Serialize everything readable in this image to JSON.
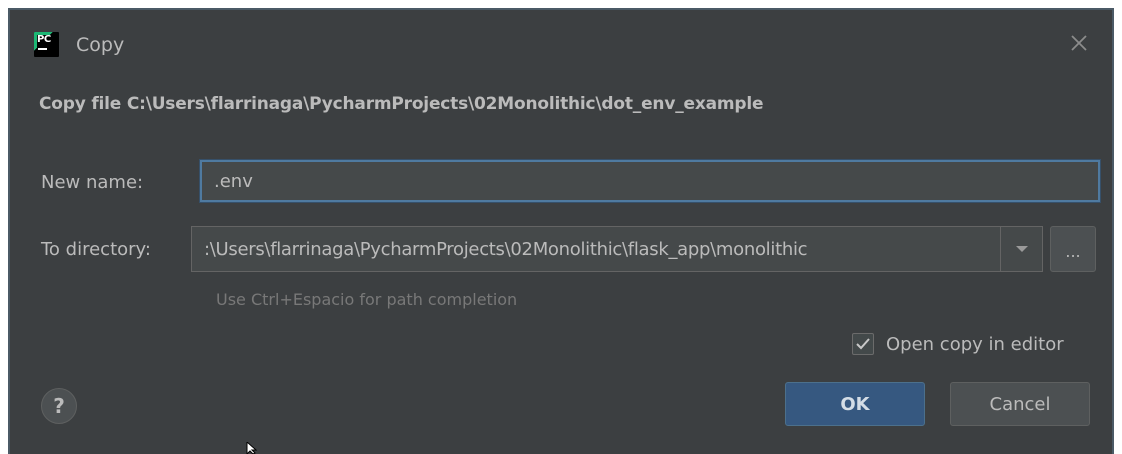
{
  "window": {
    "title": "Copy",
    "app_icon_text": "PC",
    "close_icon": "close-icon"
  },
  "header": {
    "text": "Copy file C:\\Users\\flarrinaga\\PycharmProjects\\02Monolithic\\dot_env_example"
  },
  "form": {
    "new_name_label": "New name:",
    "new_name_value": ".env",
    "to_directory_label": "To directory:",
    "to_directory_value": ":\\Users\\flarrinaga\\PycharmProjects\\02Monolithic\\flask_app\\monolithic",
    "browse_label": "...",
    "hint": "Use Ctrl+Espacio for path completion"
  },
  "options": {
    "open_copy_label": "Open copy in editor",
    "open_copy_checked": true
  },
  "footer": {
    "help_label": "?",
    "ok_label": "OK",
    "cancel_label": "Cancel"
  },
  "colors": {
    "background": "#3c3f41",
    "text": "#bbbbbb",
    "accent_button": "#365880",
    "focus_border": "#4f7aa0"
  }
}
